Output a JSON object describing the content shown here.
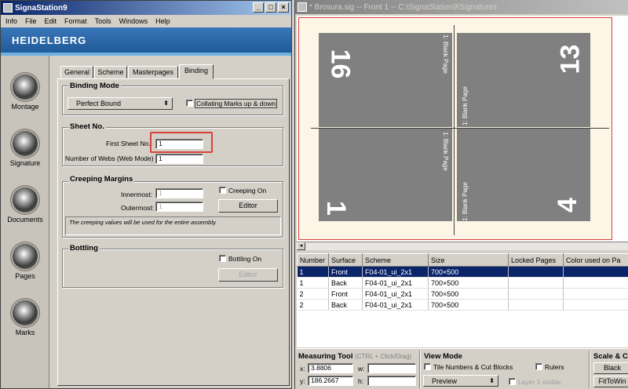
{
  "left_window": {
    "title": "SignaStation9",
    "menu": [
      "Info",
      "File",
      "Edit",
      "Format",
      "Tools",
      "Windows",
      "Help"
    ],
    "brand": "HEIDELBERG",
    "sidebar": [
      "Montage",
      "Signature",
      "Documents",
      "Pages",
      "Marks"
    ],
    "tabs": [
      "General",
      "Scheme",
      "Masterpages",
      "Binding"
    ],
    "active_tab": "Binding",
    "binding_mode": {
      "title": "Binding Mode",
      "select_value": "Perfect Bound",
      "collating_label": "Collating Marks up & down"
    },
    "sheet_no": {
      "title": "Sheet No.",
      "first_sheet_label": "First Sheet No.:",
      "first_sheet_value": "1",
      "webs_label": "Number of Webs (Web Mode) :",
      "webs_value": "1"
    },
    "creeping": {
      "title": "Creeping Margins",
      "innermost_label": "Innermost:",
      "innermost_value": "1",
      "outermost_label": "Outermost:",
      "outermost_value": "1",
      "creeping_on_label": "Creeping On",
      "editor_label": "Editor",
      "note": "The creeping values will be used for the entire assembly."
    },
    "bottling": {
      "title": "Bottling",
      "bottling_on_label": "Bottling On",
      "editor_label": "Editor"
    }
  },
  "right_window": {
    "title": "* Brosura.sig  -- Front 1 -- C:\\SignaStation9\\Signatures",
    "pages": [
      {
        "num": "16",
        "label": "1: Blank Page"
      },
      {
        "num": "13",
        "label": "1: Blank Page"
      },
      {
        "num": "1",
        "label": "1: Blank Page"
      },
      {
        "num": "4",
        "label": "1: Blank Page"
      }
    ],
    "table": {
      "headers": [
        "Number",
        "Surface",
        "Scheme",
        "Size",
        "Locked Pages",
        "Color used on Pa"
      ],
      "rows": [
        [
          "1",
          "Front",
          "F04-01_ui_2x1",
          "700×500",
          "",
          ""
        ],
        [
          "1",
          "Back",
          "F04-01_ui_2x1",
          "700×500",
          "",
          ""
        ],
        [
          "2",
          "Front",
          "F04-01_ui_2x1",
          "700×500",
          "",
          ""
        ],
        [
          "2",
          "Back",
          "F04-01_ui_2x1",
          "700×500",
          "",
          ""
        ]
      ]
    },
    "measuring": {
      "title": "Measuring Tool",
      "hint": "(CTRL + Click/Drag)",
      "x_label": "x:",
      "x_value": "3.8806",
      "y_label": "y:",
      "y_value": "186.2667",
      "w_label": "w:",
      "h_label": "h:"
    },
    "view_mode": {
      "title": "View Mode",
      "tile_label": "Tile Numbers & Cut Blocks",
      "rulers_label": "Rulers",
      "preview_value": "Preview",
      "layer_label": "Layer 1 visible"
    },
    "scale": {
      "title": "Scale & C",
      "black_label": "Black",
      "fit_label": "FitToWin"
    }
  }
}
